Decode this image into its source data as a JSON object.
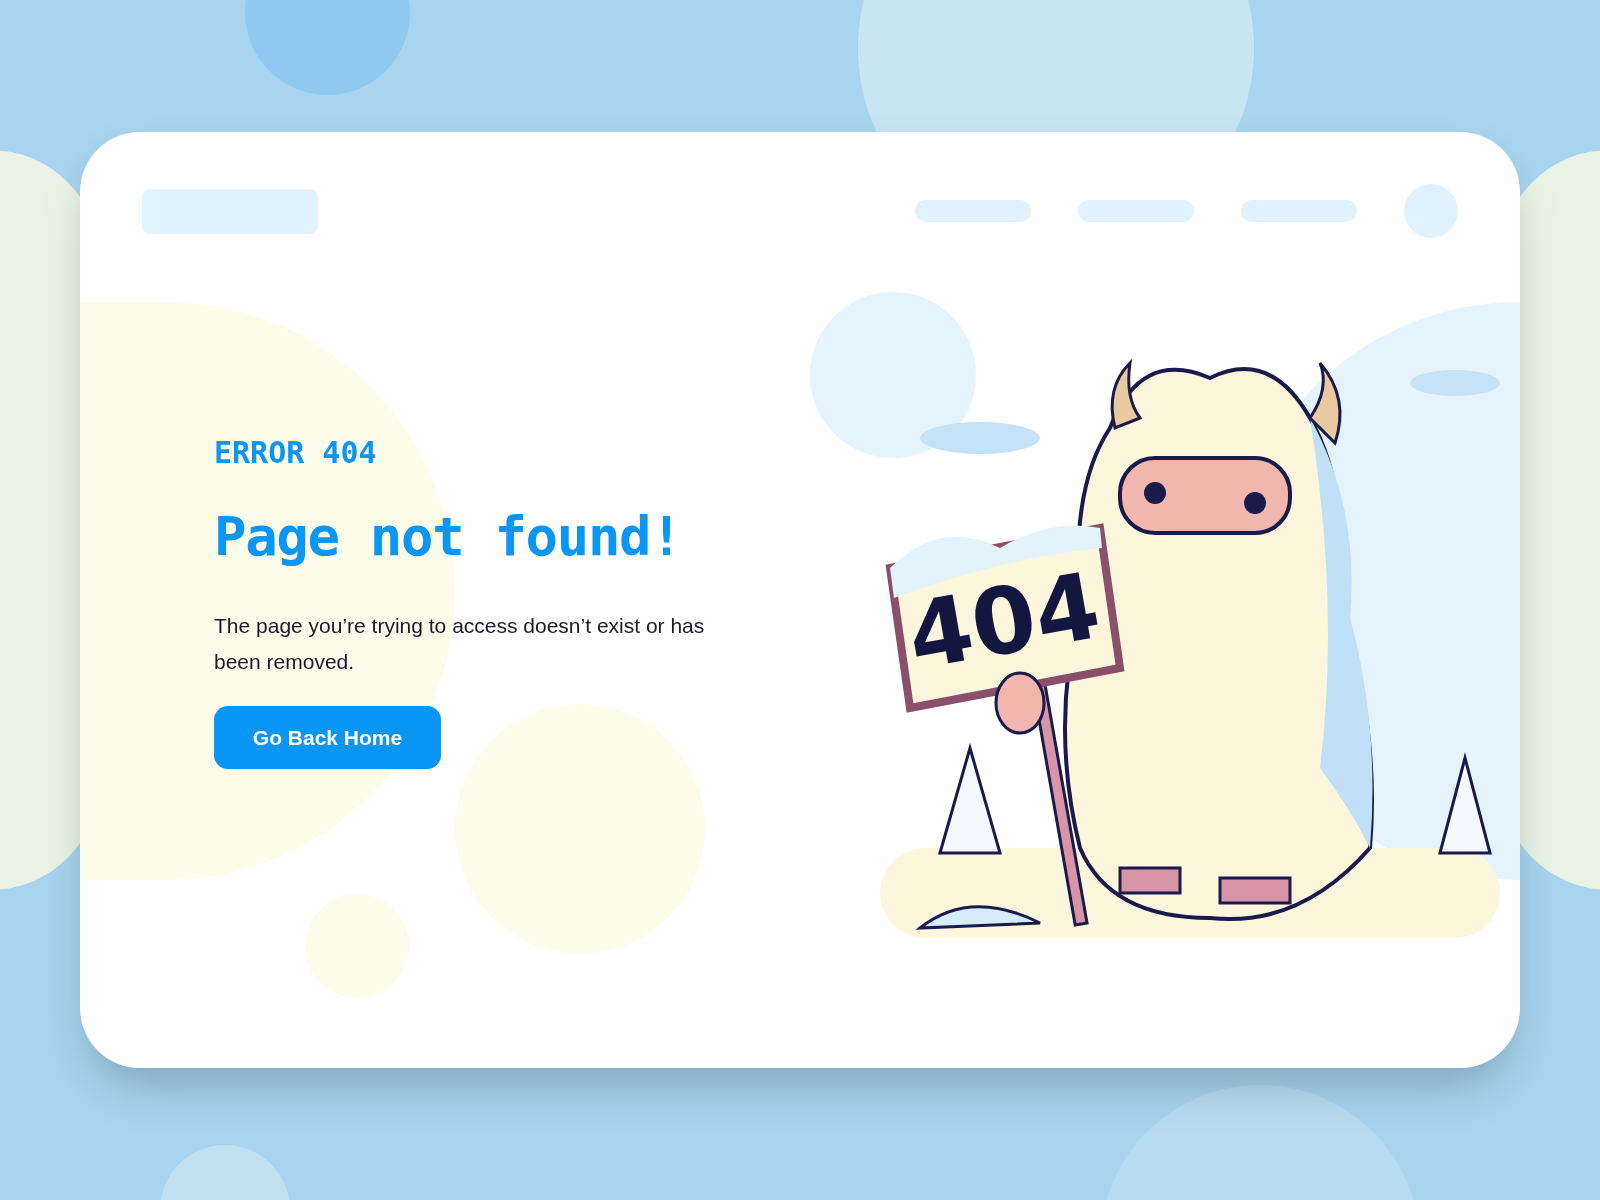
{
  "eyebrow": "ERROR 404",
  "title": "Page not found!",
  "description": "The page you’re trying to access doesn’t exist or has been removed.",
  "button": {
    "label": "Go Back Home"
  },
  "illustration": {
    "sign_text": "404"
  }
}
